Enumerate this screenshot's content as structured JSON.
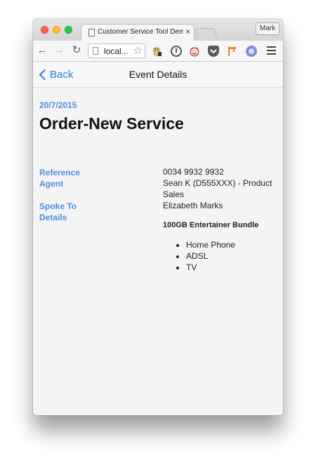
{
  "browser": {
    "tab_title": "Customer Service Tool Dem",
    "tab_close": "×",
    "profile_name": "Mark",
    "address": "local...",
    "nav_back_glyph": "←",
    "nav_forward_glyph": "→",
    "reload_glyph": "↻",
    "star_glyph": "☆",
    "accent_color": "#2c7be5"
  },
  "app": {
    "back_label": "Back",
    "title": "Event Details"
  },
  "event": {
    "date": "20/7/2015",
    "title": "Order-New Service",
    "fields": {
      "reference_label": "Reference",
      "reference_value": "0034 9932 9932",
      "agent_label": "Agent",
      "agent_value": "Sean K (D555XXX) - Product Sales",
      "spoke_to_label": "Spoke To",
      "spoke_to_value": "Elizabeth Marks",
      "details_label": "Details"
    },
    "details": {
      "title": "100GB Entertainer Bundle",
      "items": [
        "Home Phone",
        "ADSL",
        "TV"
      ]
    }
  }
}
